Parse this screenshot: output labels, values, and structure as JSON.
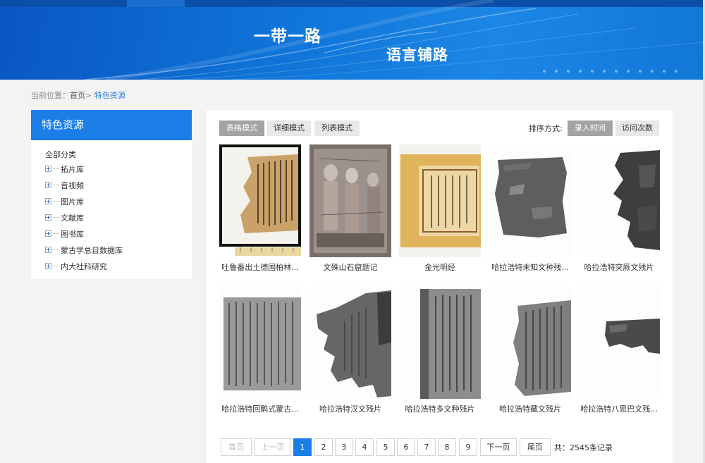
{
  "banner": {
    "title_line1": "一带一路",
    "title_line2": "语言铺路"
  },
  "breadcrumb": {
    "prefix": "当前位置：",
    "home": "首页",
    "separator": ">",
    "current": "特色资源"
  },
  "sidebar": {
    "title": "特色资源",
    "root": "全部分类",
    "items": [
      {
        "label": "拓片库"
      },
      {
        "label": "音视频"
      },
      {
        "label": "图片库"
      },
      {
        "label": "文献库"
      },
      {
        "label": "图书库"
      },
      {
        "label": "蒙古学总目数据库"
      },
      {
        "label": "内大社科研究"
      }
    ]
  },
  "toolbar": {
    "modes": [
      "表格模式",
      "详细模式",
      "列表模式"
    ],
    "active_mode": "表格模式",
    "sort_label": "排序方式:",
    "sort_options": [
      "录入时间",
      "访问次数"
    ],
    "active_sort": "录入时间"
  },
  "grid": {
    "items": [
      {
        "title": "吐鲁番出土德国柏林...",
        "thumb": "framed-manuscript"
      },
      {
        "title": "文殊山石窟题记",
        "thumb": "cave-mural"
      },
      {
        "title": "金光明经",
        "thumb": "gold-sutra"
      },
      {
        "title": "哈拉浩特未知文种残...",
        "thumb": "gray-fragment"
      },
      {
        "title": "哈拉浩特突厥文残片",
        "thumb": "gray-fragment-torn"
      },
      {
        "title": "哈拉浩特回鹘式蒙古...",
        "thumb": "gray-script"
      },
      {
        "title": "哈拉浩特汉文残片",
        "thumb": "gray-fragment-torn"
      },
      {
        "title": "哈拉浩特多文种残片",
        "thumb": "gray-script-vertical"
      },
      {
        "title": "哈拉浩特藏文残片",
        "thumb": "gray-script"
      },
      {
        "title": "哈拉浩特八思巴文残...",
        "thumb": "gray-fragment-small"
      }
    ]
  },
  "pagination": {
    "first": "首页",
    "prev": "上一页",
    "pages": [
      "1",
      "2",
      "3",
      "4",
      "5",
      "6",
      "7",
      "8",
      "9"
    ],
    "current": "1",
    "next": "下一页",
    "last": "尾页",
    "total_prefix": "共：",
    "total_count": "2545",
    "total_suffix": "条记录"
  },
  "colors": {
    "accent": "#1b7de6",
    "banner_dark": "#0a56c4",
    "active_gray": "#a3a3a3"
  }
}
